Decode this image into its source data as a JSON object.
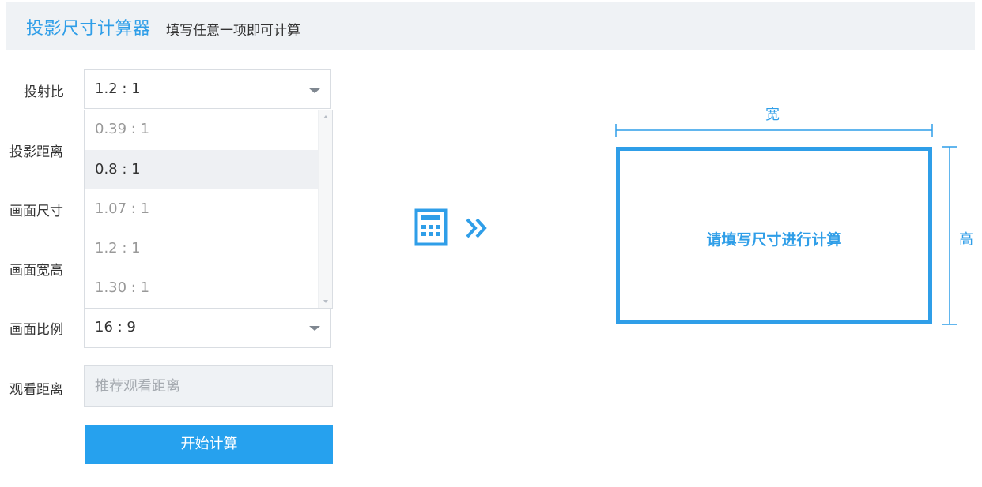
{
  "header": {
    "title": "投影尺寸计算器",
    "subtitle": "填写任意一项即可计算"
  },
  "form": {
    "throw_ratio": {
      "label": "投射比",
      "value": "1.2 : 1",
      "options": [
        "0.39 : 1",
        "0.8 : 1",
        "1.07 : 1",
        "1.2 : 1",
        "1.30 : 1"
      ],
      "highlighted_option": "0.8 : 1"
    },
    "projection_distance": {
      "label": "投影距离"
    },
    "screen_size": {
      "label": "画面尺寸"
    },
    "screen_width_height": {
      "label": "画面宽高"
    },
    "aspect_ratio": {
      "label": "画面比例",
      "value": "16 : 9"
    },
    "viewing_distance": {
      "label": "观看距离",
      "placeholder": "推荐观看距离",
      "value": ""
    },
    "start_button": "开始计算"
  },
  "diagram": {
    "width_label": "宽",
    "height_label": "高",
    "frame_text": "请填写尺寸进行计算"
  },
  "icons": {
    "calculator": "calculator-icon",
    "chevron": "double-chevron-right-icon",
    "select_caret": "caret-down-icon"
  },
  "colors": {
    "accent": "#2f9ee8",
    "button": "#26a1ee",
    "header_bg": "#eff2f5"
  }
}
